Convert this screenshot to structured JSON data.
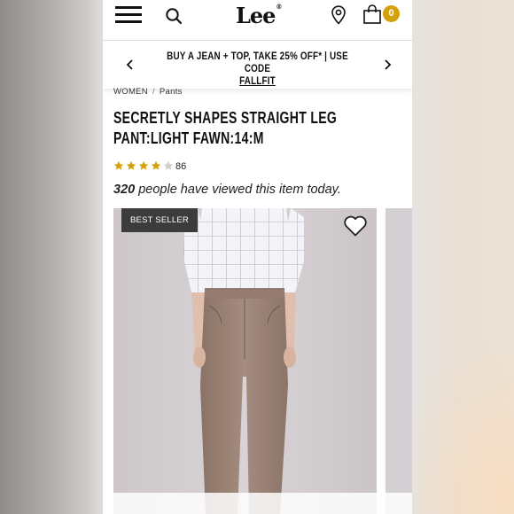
{
  "header": {
    "logo_text": "Lee",
    "logo_mark": "®",
    "cart_count": "0",
    "icons": [
      "menu-icon",
      "search-icon",
      "location-pin-icon",
      "shopping-bag-icon"
    ]
  },
  "promo": {
    "text": "BUY A JEAN + TOP, TAKE 25% OFF* | USE CODE",
    "code": "FALLFIT"
  },
  "breadcrumb": {
    "items": [
      "WOMEN",
      "Pants"
    ],
    "separator": "/"
  },
  "product": {
    "title_line1": "SECRETLY SHAPES STRAIGHT LEG",
    "title_line2": "PANT:LIGHT FAWN:14:M",
    "rating": 4,
    "rating_max": 5,
    "review_count": "86",
    "views_count": "320",
    "views_text": " people have viewed this item today.",
    "badge": "BEST SELLER"
  },
  "colors": {
    "accent": "#d4a10d",
    "star_filled": "#d4a10d",
    "star_empty": "#cfcfcf",
    "badge_bg": "#3c3c3c"
  }
}
